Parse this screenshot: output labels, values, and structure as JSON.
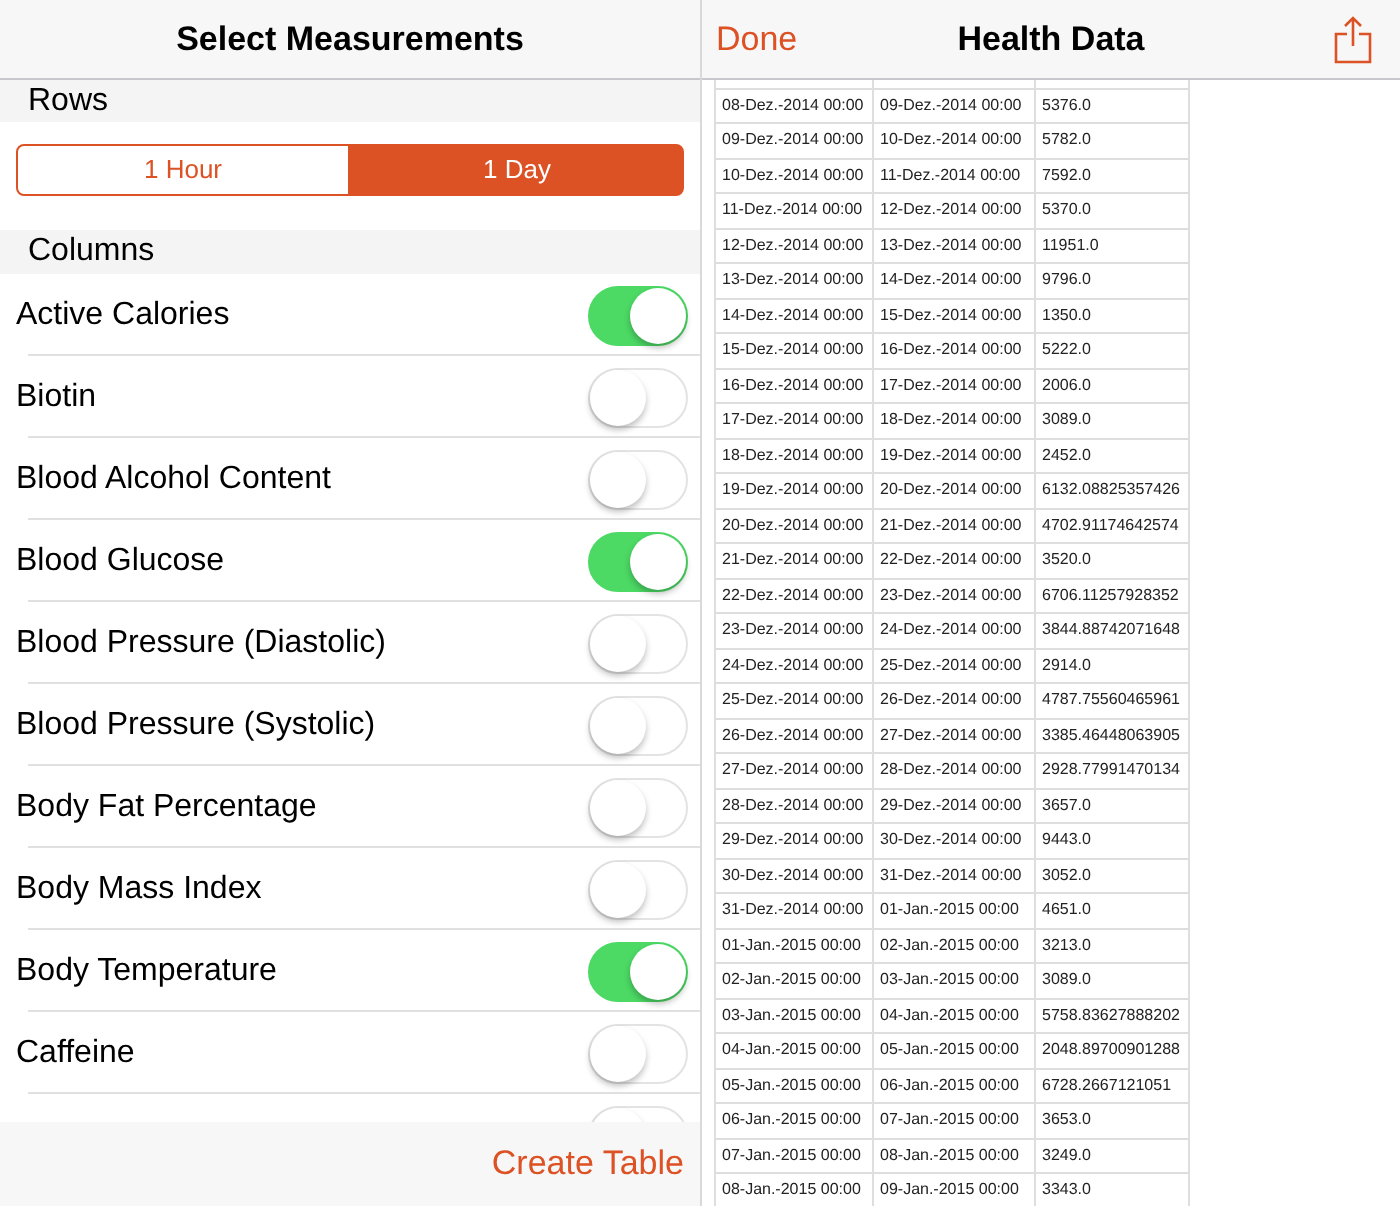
{
  "measurements_panel": {
    "title": "Select Measurements",
    "rows_section": {
      "heading": "Rows",
      "options": [
        {
          "label": "1 Hour",
          "selected": false
        },
        {
          "label": "1 Day",
          "selected": true
        }
      ]
    },
    "columns_section": {
      "heading": "Columns",
      "items": [
        {
          "label": "Active Calories",
          "on": true
        },
        {
          "label": "Biotin",
          "on": false
        },
        {
          "label": "Blood Alcohol Content",
          "on": false
        },
        {
          "label": "Blood Glucose",
          "on": true
        },
        {
          "label": "Blood Pressure (Diastolic)",
          "on": false
        },
        {
          "label": "Blood Pressure (Systolic)",
          "on": false
        },
        {
          "label": "Body Fat Percentage",
          "on": false
        },
        {
          "label": "Body Mass Index",
          "on": false
        },
        {
          "label": "Body Temperature",
          "on": true
        },
        {
          "label": "Caffeine",
          "on": false
        },
        {
          "on": false
        }
      ]
    },
    "create_button": "Create Table"
  },
  "data_panel": {
    "done_button": "Done",
    "title": "Health Data",
    "table": {
      "rows": [
        [
          "08-Dez.-2014 00:00",
          "09-Dez.-2014 00:00",
          "5376.0"
        ],
        [
          "09-Dez.-2014 00:00",
          "10-Dez.-2014 00:00",
          "5782.0"
        ],
        [
          "10-Dez.-2014 00:00",
          "11-Dez.-2014 00:00",
          "7592.0"
        ],
        [
          "11-Dez.-2014 00:00",
          "12-Dez.-2014 00:00",
          "5370.0"
        ],
        [
          "12-Dez.-2014 00:00",
          "13-Dez.-2014 00:00",
          "11951.0"
        ],
        [
          "13-Dez.-2014 00:00",
          "14-Dez.-2014 00:00",
          "9796.0"
        ],
        [
          "14-Dez.-2014 00:00",
          "15-Dez.-2014 00:00",
          "1350.0"
        ],
        [
          "15-Dez.-2014 00:00",
          "16-Dez.-2014 00:00",
          "5222.0"
        ],
        [
          "16-Dez.-2014 00:00",
          "17-Dez.-2014 00:00",
          "2006.0"
        ],
        [
          "17-Dez.-2014 00:00",
          "18-Dez.-2014 00:00",
          "3089.0"
        ],
        [
          "18-Dez.-2014 00:00",
          "19-Dez.-2014 00:00",
          "2452.0"
        ],
        [
          "19-Dez.-2014 00:00",
          "20-Dez.-2014 00:00",
          "6132.08825357426"
        ],
        [
          "20-Dez.-2014 00:00",
          "21-Dez.-2014 00:00",
          "4702.91174642574"
        ],
        [
          "21-Dez.-2014 00:00",
          "22-Dez.-2014 00:00",
          "3520.0"
        ],
        [
          "22-Dez.-2014 00:00",
          "23-Dez.-2014 00:00",
          "6706.11257928352"
        ],
        [
          "23-Dez.-2014 00:00",
          "24-Dez.-2014 00:00",
          "3844.88742071648"
        ],
        [
          "24-Dez.-2014 00:00",
          "25-Dez.-2014 00:00",
          "2914.0"
        ],
        [
          "25-Dez.-2014 00:00",
          "26-Dez.-2014 00:00",
          "4787.75560465961"
        ],
        [
          "26-Dez.-2014 00:00",
          "27-Dez.-2014 00:00",
          "3385.46448063905"
        ],
        [
          "27-Dez.-2014 00:00",
          "28-Dez.-2014 00:00",
          "2928.77991470134"
        ],
        [
          "28-Dez.-2014 00:00",
          "29-Dez.-2014 00:00",
          "3657.0"
        ],
        [
          "29-Dez.-2014 00:00",
          "30-Dez.-2014 00:00",
          "9443.0"
        ],
        [
          "30-Dez.-2014 00:00",
          "31-Dez.-2014 00:00",
          "3052.0"
        ],
        [
          "31-Dez.-2014 00:00",
          "01-Jan.-2015 00:00",
          "4651.0"
        ],
        [
          "01-Jan.-2015 00:00",
          "02-Jan.-2015 00:00",
          "3213.0"
        ],
        [
          "02-Jan.-2015 00:00",
          "03-Jan.-2015 00:00",
          "3089.0"
        ],
        [
          "03-Jan.-2015 00:00",
          "04-Jan.-2015 00:00",
          "5758.83627888202"
        ],
        [
          "04-Jan.-2015 00:00",
          "05-Jan.-2015 00:00",
          "2048.89700901288"
        ],
        [
          "05-Jan.-2015 00:00",
          "06-Jan.-2015 00:00",
          "6728.2667121051"
        ],
        [
          "06-Jan.-2015 00:00",
          "07-Jan.-2015 00:00",
          "3653.0"
        ],
        [
          "07-Jan.-2015 00:00",
          "08-Jan.-2015 00:00",
          "3249.0"
        ],
        [
          "08-Jan.-2015 00:00",
          "09-Jan.-2015 00:00",
          "3343.0"
        ]
      ]
    }
  }
}
